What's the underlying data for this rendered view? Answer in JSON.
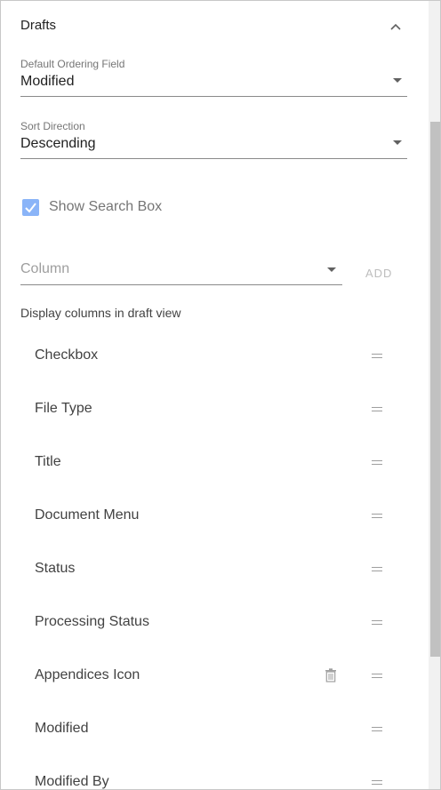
{
  "section": {
    "title": "Drafts",
    "collapse_icon": "chevron-up-icon"
  },
  "ordering_field": {
    "label": "Default Ordering Field",
    "value": "Modified"
  },
  "sort_direction": {
    "label": "Sort Direction",
    "value": "Descending"
  },
  "show_search_box": {
    "label": "Show Search Box",
    "checked": true
  },
  "column_picker": {
    "placeholder": "Column",
    "add_label": "ADD"
  },
  "display_columns": {
    "caption": "Display columns in draft view",
    "items": [
      {
        "label": "Checkbox"
      },
      {
        "label": "File Type"
      },
      {
        "label": "Title"
      },
      {
        "label": "Document Menu"
      },
      {
        "label": "Status"
      },
      {
        "label": "Processing Status"
      },
      {
        "label": "Appendices Icon",
        "deletable": true
      },
      {
        "label": "Modified"
      },
      {
        "label": "Modified By"
      }
    ]
  },
  "colors": {
    "accent": "#8ab4f8",
    "text": "#212121",
    "muted": "#757575"
  }
}
